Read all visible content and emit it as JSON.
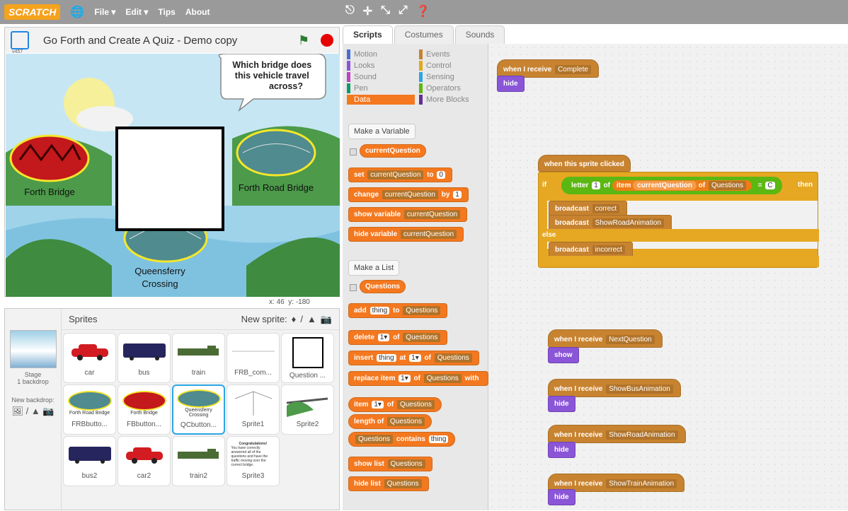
{
  "app": {
    "logo": "SCRATCH",
    "menus": [
      "File ▾",
      "Edit ▾",
      "Tips",
      "About"
    ]
  },
  "project": {
    "title": "Go Forth and Create A Quiz - Demo copy",
    "version": "v457"
  },
  "stage": {
    "speech": "Which bridge does this vehicle travel across?",
    "labels": [
      "Forth Bridge",
      "Forth Road Bridge",
      "Queensferry Crossing"
    ],
    "x": "46",
    "y": "-180"
  },
  "sprites_panel": {
    "title": "Sprites",
    "new_sprite": "New sprite:",
    "stage_label": "Stage",
    "stage_sub": "1 backdrop",
    "new_backdrop": "New backdrop:",
    "sprites": [
      "car",
      "bus",
      "train",
      "FRB_com...",
      "Question ...",
      "FRBbutto...",
      "FBbutton...",
      "QCbutton...",
      "Sprite1",
      "Sprite2",
      "bus2",
      "car2",
      "train2",
      "Sprite3"
    ],
    "thumb_texts": {
      "frb": "Forth Road Bridge",
      "fb": "Forth Bridge",
      "qc": "Queensferry Crossing",
      "s3_head": "Congratulations!",
      "s3_body": "You have correctly answered all of the questions and have the traffic moving over the correct bridge."
    }
  },
  "tabs": [
    "Scripts",
    "Costumes",
    "Sounds"
  ],
  "palette": {
    "categories": [
      "Motion",
      "Events",
      "Looks",
      "Control",
      "Sound",
      "Sensing",
      "Pen",
      "Operators",
      "Data",
      "More Blocks"
    ],
    "category_colors": [
      "#4a6cd4",
      "#c88330",
      "#8a55d7",
      "#e1a91a",
      "#bb42c3",
      "#2ca5e2",
      "#0e9a6c",
      "#5cb712",
      "#ee7d16",
      "#632d99"
    ],
    "make_variable": "Make a Variable",
    "make_list": "Make a List",
    "var_name": "currentQuestion",
    "list_name": "Questions",
    "blocks": {
      "set": "set",
      "to": "to",
      "set_val": "0",
      "change": "change",
      "by": "by",
      "change_val": "1",
      "show_var": "show variable",
      "hide_var": "hide variable",
      "add": "add",
      "thing": "thing",
      "to2": "to",
      "delete": "delete",
      "of": "of",
      "insert": "insert",
      "at": "at",
      "replace": "replace item",
      "with": "with",
      "item": "item",
      "length": "length of",
      "contains": "contains",
      "show_list": "show list",
      "hide_list": "hide list",
      "num1": "1▾"
    }
  },
  "scripts": {
    "when_receive": "when I receive",
    "complete": "Complete",
    "hide": "hide",
    "show": "show",
    "when_clicked": "when this sprite clicked",
    "if": "if",
    "then": "then",
    "else": "else",
    "letter": "letter",
    "one": "1",
    "of": "of",
    "item": "item",
    "eq": "=",
    "c": "C",
    "broadcast": "broadcast",
    "correct": "correct",
    "show_road": "ShowRoadAnimation",
    "incorrect": "incorrect",
    "next_q": "NextQuestion",
    "show_bus": "ShowBusAnimation",
    "show_train": "ShowTrainAnimation"
  }
}
